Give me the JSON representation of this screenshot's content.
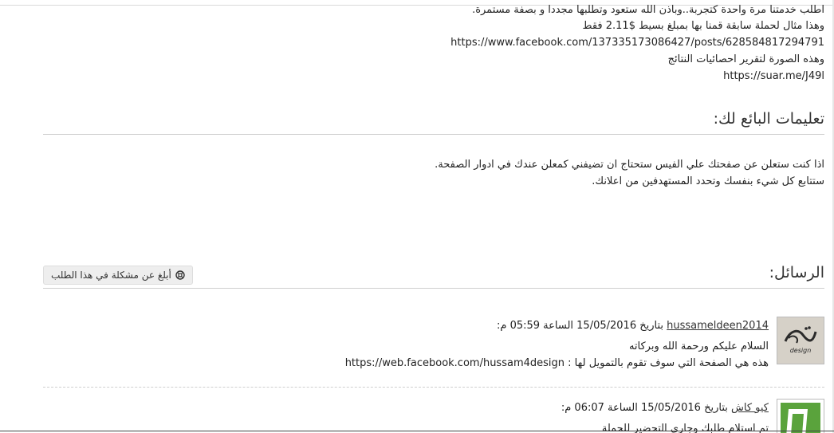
{
  "description": {
    "lines": [
      "اطلب خدمتنا مرة واحدة كتجربة..وباذن الله ستعود وتطلبها مجددا و بصفة مستمرة.",
      "وهذا مثال لحملة سابقة قمنا بها بمبلغ بسيط $2.11 فقط",
      "https://www.facebook.com/137335173086427/posts/628584817294791",
      "وهذه الصورة لتقرير احصائيات النتائج",
      "https://suar.me/J49l"
    ]
  },
  "instructions": {
    "title": "تعليمات البائع لك:",
    "lines": [
      "اذا كنت ستعلن عن صفحتك علي الفيس ستحتاج ان تضيفني كمعلن عندك في ادوار الصفحة.",
      "ستتابع كل شيء بنفسك وتحدد المستهدفين من اعلانك."
    ]
  },
  "messages_section": {
    "title": "الرسائل:",
    "report_button_label": "أبلغ عن مشكلة في هذا الطلب",
    "report_icon": "lifebuoy-icon"
  },
  "messages": [
    {
      "username": "hussameldeen2014",
      "date_text": "بتاريخ 15/05/2016 الساعة 05:59 م:",
      "body": [
        "السلام عليكم ورحمة الله وبركاته",
        "هذه هي الصفحة التي سوف تقوم بالتمويل لها : https://web.facebook.com/hussam4design"
      ],
      "avatar_icon": "design-logo-avatar",
      "avatar_text": "design"
    },
    {
      "username": "كيو كاش",
      "date_text": "بتاريخ 15/05/2016 الساعة 06:07 م:",
      "body": [
        "تم استلام طلبك وجاري التحضير للحملة"
      ],
      "avatar_icon": "green-logo-avatar"
    }
  ],
  "colors": {
    "rule": "#cfcfcf",
    "button_bg": "#eeeeee",
    "avatar_green": "#5aa33c"
  }
}
